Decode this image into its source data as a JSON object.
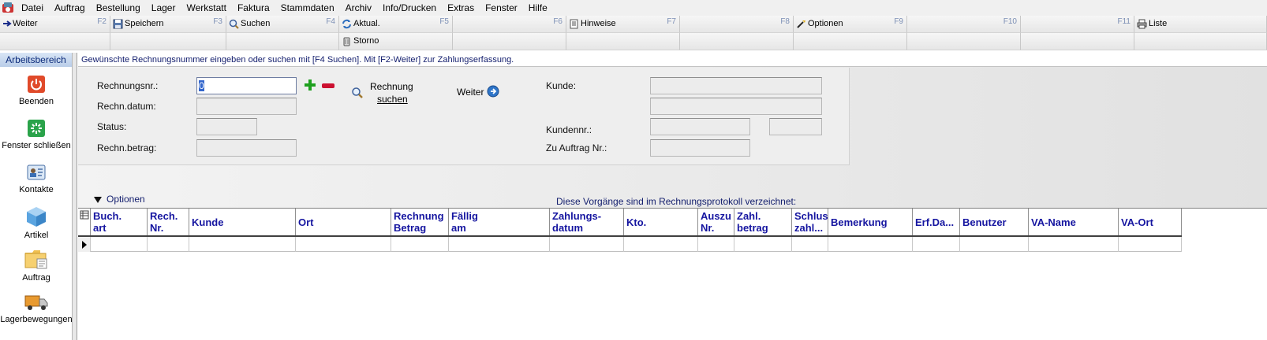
{
  "menu": [
    "Datei",
    "Auftrag",
    "Bestellung",
    "Lager",
    "Werkstatt",
    "Faktura",
    "Stammdaten",
    "Archiv",
    "Info/Drucken",
    "Extras",
    "Fenster",
    "Hilfe"
  ],
  "fkeys": [
    {
      "label": "Weiter",
      "key": "F2",
      "icon": "arrow-right-icon"
    },
    {
      "label": "Speichern",
      "key": "F3",
      "icon": "save-icon"
    },
    {
      "label": "Suchen",
      "key": "F4",
      "icon": "search-icon"
    },
    {
      "label": "Aktual.",
      "key": "F5",
      "icon": "refresh-icon"
    },
    {
      "label": "",
      "key": "F6",
      "icon": ""
    },
    {
      "label": "Hinweise",
      "key": "F7",
      "icon": "notes-icon"
    },
    {
      "label": "",
      "key": "F8",
      "icon": ""
    },
    {
      "label": "Optionen",
      "key": "F9",
      "icon": "options-icon"
    },
    {
      "label": "",
      "key": "F10",
      "icon": ""
    },
    {
      "label": "",
      "key": "F11",
      "icon": ""
    },
    {
      "label": "Liste",
      "key": "",
      "icon": "print-icon"
    }
  ],
  "fkeys_row2": {
    "storno": "Storno"
  },
  "sidebar": {
    "title": "Arbeitsbereich",
    "items": [
      {
        "label": "Beenden",
        "icon": "power-icon"
      },
      {
        "label": "Fenster schließen",
        "icon": "close-window-icon"
      },
      {
        "label": "Kontakte",
        "icon": "contacts-icon"
      },
      {
        "label": "Artikel",
        "icon": "box-icon"
      },
      {
        "label": "Auftrag",
        "icon": "folder-icon"
      },
      {
        "label": "Lagerbewegungen",
        "icon": "truck-icon"
      }
    ]
  },
  "info_text": "Gewünschte Rechnungsnummer eingeben oder suchen mit [F4 Suchen]. Mit [F2-Weiter] zur Zahlungserfassung.",
  "form": {
    "rechnungsnr_label": "Rechnungsnr.:",
    "rechnungsnr_value": "0",
    "rechn_datum_label": "Rechn.datum:",
    "status_label": "Status:",
    "rechn_betrag_label": "Rechn.betrag:",
    "search_label_1": "Rechnung",
    "search_label_2": "suchen",
    "weiter_label": "Weiter",
    "kunde_label": "Kunde:",
    "kundennr_label": "Kundennr.:",
    "zu_auftrag_label": "Zu Auftrag Nr.:"
  },
  "optionen_label": "Optionen",
  "protocol_note": "Diese Vorgänge sind im Rechnungsprotokoll verzeichnet:",
  "grid": {
    "columns": [
      "Buch.\nart",
      "Rech.\nNr.",
      "Kunde",
      "Ort",
      "Rechnung\nBetrag",
      "Fällig\nam",
      "Zahlungs-\ndatum",
      "Kto.",
      "Auszu\nNr.",
      "Zahl.\nbetrag",
      "Schlus\nzahl...",
      "Bemerkung",
      "Erf.Da...",
      "Benutzer",
      "VA-Name",
      "VA-Ort"
    ]
  },
  "colors": {
    "accent": "#15206f",
    "header_text": "#1515a0",
    "sidebar_title_bg": "#c6d7ee"
  }
}
